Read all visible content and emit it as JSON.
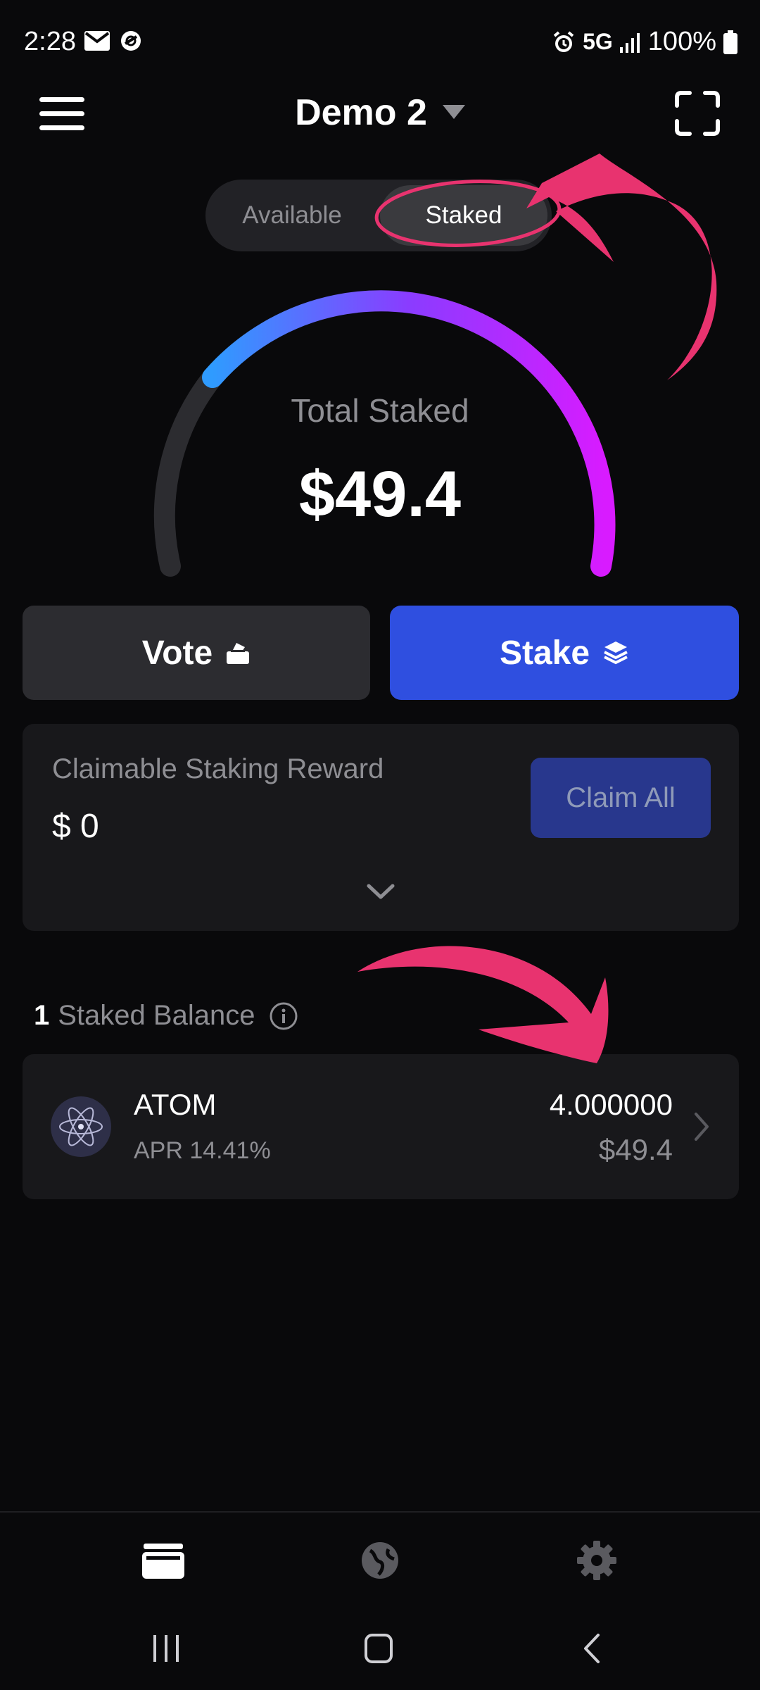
{
  "status_bar": {
    "time": "2:28",
    "network": "5G",
    "battery": "100%",
    "left_icons": [
      "mail-icon",
      "no-disturb-icon"
    ],
    "right_icons": [
      "alarm-icon",
      "signal-icon",
      "battery-icon"
    ]
  },
  "header": {
    "wallet_name": "Demo 2",
    "menu_icon": "hamburger-menu-icon",
    "scan_icon": "scan-frame-icon"
  },
  "segment": {
    "options": [
      "Available",
      "Staked"
    ],
    "selected": "Staked"
  },
  "gauge": {
    "label": "Total Staked",
    "value": "$49.4",
    "gradient_colors": [
      "#2f9bff",
      "#8a3cff",
      "#d81bff"
    ],
    "track_color": "#2c2c30"
  },
  "actions": {
    "vote_label": "Vote",
    "vote_icon": "ballot-box-icon",
    "stake_label": "Stake",
    "stake_icon": "layers-icon"
  },
  "reward": {
    "title": "Claimable Staking Reward",
    "amount": "$ 0",
    "claim_label": "Claim All",
    "expand_icon": "chevron-down-icon"
  },
  "staked_balance": {
    "count": "1",
    "heading": "Staked Balance",
    "info_icon": "info-icon",
    "items": [
      {
        "symbol": "ATOM",
        "apr": "APR 14.41%",
        "amount": "4.000000",
        "value": "$49.4",
        "logo_icon": "cosmos-atom-icon"
      }
    ]
  },
  "tabbar": {
    "tabs": [
      "wallet-icon",
      "globe-icon",
      "gear-icon"
    ],
    "active": "wallet-icon"
  },
  "colors": {
    "background": "#09090b",
    "card": "#18181b",
    "accent_blue": "#2f4fe0",
    "annotation_pink": "#e8336f"
  }
}
